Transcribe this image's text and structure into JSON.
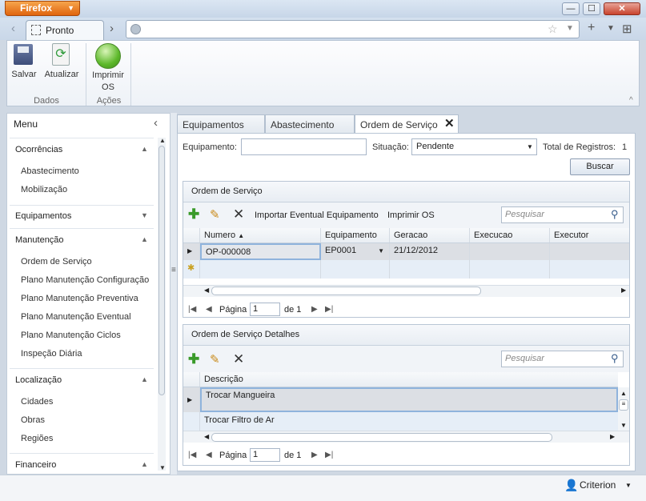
{
  "browser": {
    "app_button": "Firefox",
    "tab_title": "Pronto",
    "window_controls": {
      "minimize": "—",
      "maximize": "☐",
      "close": "✕"
    }
  },
  "ribbon": {
    "groups": [
      {
        "label": "Dados",
        "buttons": [
          {
            "label": "Salvar",
            "icon": "save-icon"
          },
          {
            "label": "Atualizar",
            "icon": "refresh-icon"
          }
        ]
      },
      {
        "label": "Ações",
        "buttons": [
          {
            "label": "Imprimir OS",
            "icon": "print-orb-icon"
          }
        ]
      }
    ],
    "salvar": "Salvar",
    "atualizar": "Atualizar",
    "imprimir_line1": "Imprimir",
    "imprimir_line2": "OS",
    "group_dados": "Dados",
    "group_acoes": "Ações"
  },
  "sidebar": {
    "title": "Menu",
    "collapse": "‹",
    "sections": {
      "ocorrencias": {
        "label": "Ocorrências",
        "items": [
          "Abastecimento",
          "Mobilização"
        ]
      },
      "equipamentos": {
        "label": "Equipamentos"
      },
      "manutencao": {
        "label": "Manutenção",
        "items": [
          "Ordem de Serviço",
          "Plano Manutenção Configuração",
          "Plano Manutenção Preventiva",
          "Plano Manutenção Eventual",
          "Plano Manutenção Ciclos",
          "Inspeção Diária"
        ]
      },
      "localizacao": {
        "label": "Localização",
        "items": [
          "Cidades",
          "Obras",
          "Regiões"
        ]
      },
      "financeiro": {
        "label": "Financeiro"
      }
    }
  },
  "tabs": {
    "t1": "Equipamentos",
    "t2": "Abastecimento",
    "t3": "Ordem de Serviço"
  },
  "filter": {
    "equip_label": "Equipamento:",
    "equip_value": "",
    "situacao_label": "Situação:",
    "situacao_value": "Pendente",
    "total_label": "Total de Registros:",
    "total_value": "1",
    "search_button": "Buscar"
  },
  "os_panel": {
    "title": "Ordem de Serviço",
    "import_label": "Importar Eventual Equipamento",
    "print_label": "Imprimir OS",
    "search_placeholder": "Pesquisar",
    "columns": {
      "c1": "Numero",
      "c2": "Equipamento",
      "c3": "Geracao",
      "c4": "Execucao",
      "c5": "Executor"
    },
    "row": {
      "numero": "OP-000008",
      "equipamento": "EP0001",
      "geracao": "21/12/2012",
      "execucao": "",
      "executor": ""
    },
    "pager": {
      "page_label": "Página",
      "page": "1",
      "of": "de 1"
    }
  },
  "detail_panel": {
    "title": "Ordem de Serviço Detalhes",
    "search_placeholder": "Pesquisar",
    "column": "Descrição",
    "rows": {
      "r1": "Trocar Mangueira",
      "r2": "Trocar Filtro de Ar"
    },
    "pager": {
      "page_label": "Página",
      "page": "1",
      "of": "de 1"
    }
  },
  "status": {
    "user": "Criterion"
  }
}
